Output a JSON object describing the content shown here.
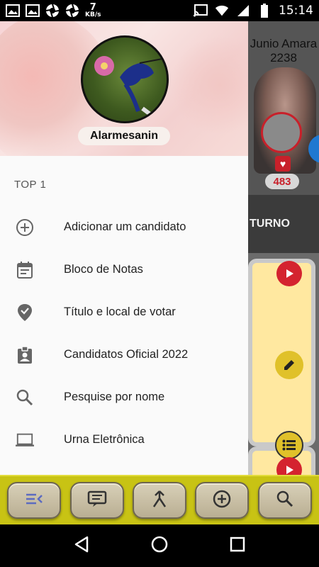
{
  "status_bar": {
    "speed_value": "7",
    "speed_unit": "KB/s",
    "time": "15:14",
    "left_icons": [
      "image-icon",
      "image-icon",
      "aperture-icon",
      "aperture-icon"
    ],
    "right_icons": [
      "cast-icon",
      "wifi-icon",
      "signal-icon",
      "battery-icon"
    ]
  },
  "background_app": {
    "candidate_name": "Junio Amara",
    "candidate_number": "2238",
    "likes_count": "483",
    "turno_label": "TURNO"
  },
  "drawer": {
    "username": "Alarmesanin",
    "section_title": "TOP 1",
    "items": [
      {
        "label": "Adicionar um candidato",
        "icon": "add-circle-icon"
      },
      {
        "label": "Bloco de Notas",
        "icon": "calendar-icon"
      },
      {
        "label": "Título e local de votar",
        "icon": "verified-location-icon"
      },
      {
        "label": "Candidatos Oficial 2022",
        "icon": "badge-icon"
      },
      {
        "label": "Pesquise por nome",
        "icon": "search-icon"
      },
      {
        "label": "Urna Eletrônica",
        "icon": "laptop-icon"
      }
    ]
  },
  "toolbar": {
    "buttons": [
      "menu-icon",
      "message-icon",
      "merge-icon",
      "add-circle-icon",
      "search-icon"
    ],
    "accent": "#c8c314",
    "active_icon_color": "#5c6bc0"
  },
  "nav_bar": {
    "buttons": [
      "back-icon",
      "home-icon",
      "recents-icon"
    ]
  }
}
